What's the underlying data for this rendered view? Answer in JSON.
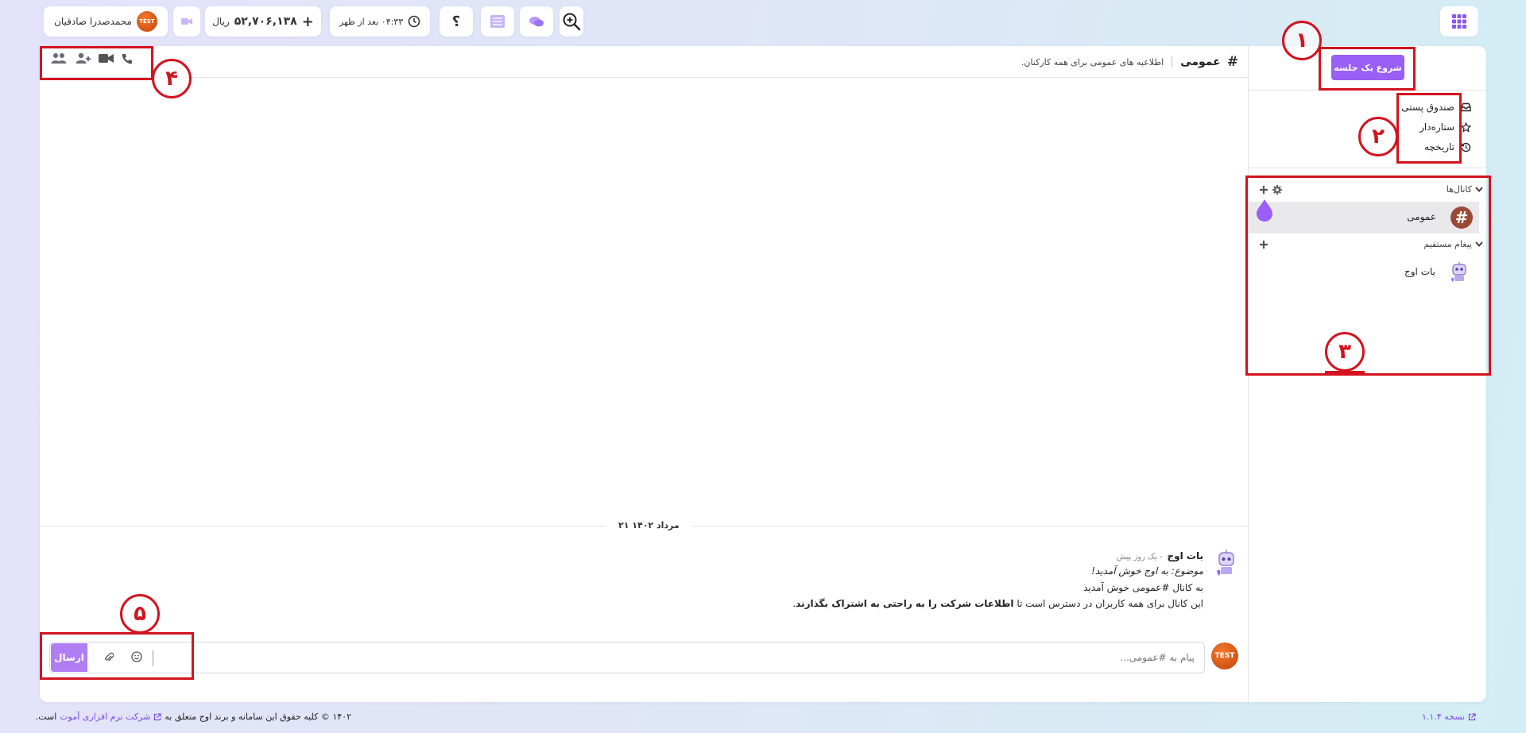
{
  "topbar": {
    "user_name": "محمدصدرا صادقیان",
    "user_badge": "TEST",
    "balance_amount": "۵۲,۷۰۶,۱۳۸",
    "balance_currency": "ریال",
    "balance_plus": "+",
    "time_text": "۰۴:۳۳ بعد از ظهر",
    "help_label": "؟"
  },
  "sidebar": {
    "start_meeting": "شروع یک جلسه",
    "nav": [
      {
        "label": "صندوق پستی",
        "icon": "inbox-icon"
      },
      {
        "label": "ستاره‌دار",
        "icon": "star-icon"
      },
      {
        "label": "تاریخچه",
        "icon": "history-icon"
      }
    ],
    "channels_title": "کانال‌ها",
    "channels": [
      {
        "name": "عمومی"
      }
    ],
    "dm_title": "پیغام مستقیم",
    "dms": [
      {
        "name": "بات اوج"
      }
    ]
  },
  "channel_header": {
    "hash": "#",
    "name": "عمومی",
    "topic": "اطلاعیه های عمومی برای همه کارکنان."
  },
  "messages": {
    "date_divider": "۲۱ مرداد ۱۴۰۲",
    "items": [
      {
        "author": "بات اوج",
        "time": "- یک روز پیش",
        "subject_prefix": "موضوع:",
        "subject": "به اوج خوش آمدید!",
        "line1": "به کانال #عمومی خوش آمدید",
        "line2_plain": "این کانال برای همه کاربران در دسترس است تا",
        "line2_bold": "اطلاعات شرکت را به راحتی به اشتراک بگذارند",
        "line2_end": "."
      }
    ]
  },
  "composer": {
    "placeholder": "پیام به #عمومی...",
    "send": "ارسال",
    "avatar_badge": "TEST"
  },
  "footer": {
    "copyright": "۱۴۰۲ © کلیه حقوق این سامانه و برند اوج متعلق به",
    "company": "شرکت نرم افزاری آموت",
    "copyright_end": "است.",
    "version": "نسخه ۱.۱.۴"
  },
  "annotations": [
    "۱",
    "۲",
    "۳",
    "۴",
    "۵"
  ],
  "colors": {
    "accent": "#9a5ff5",
    "annotation": "#d3131f",
    "channel_avatar": "#9b4a37"
  }
}
